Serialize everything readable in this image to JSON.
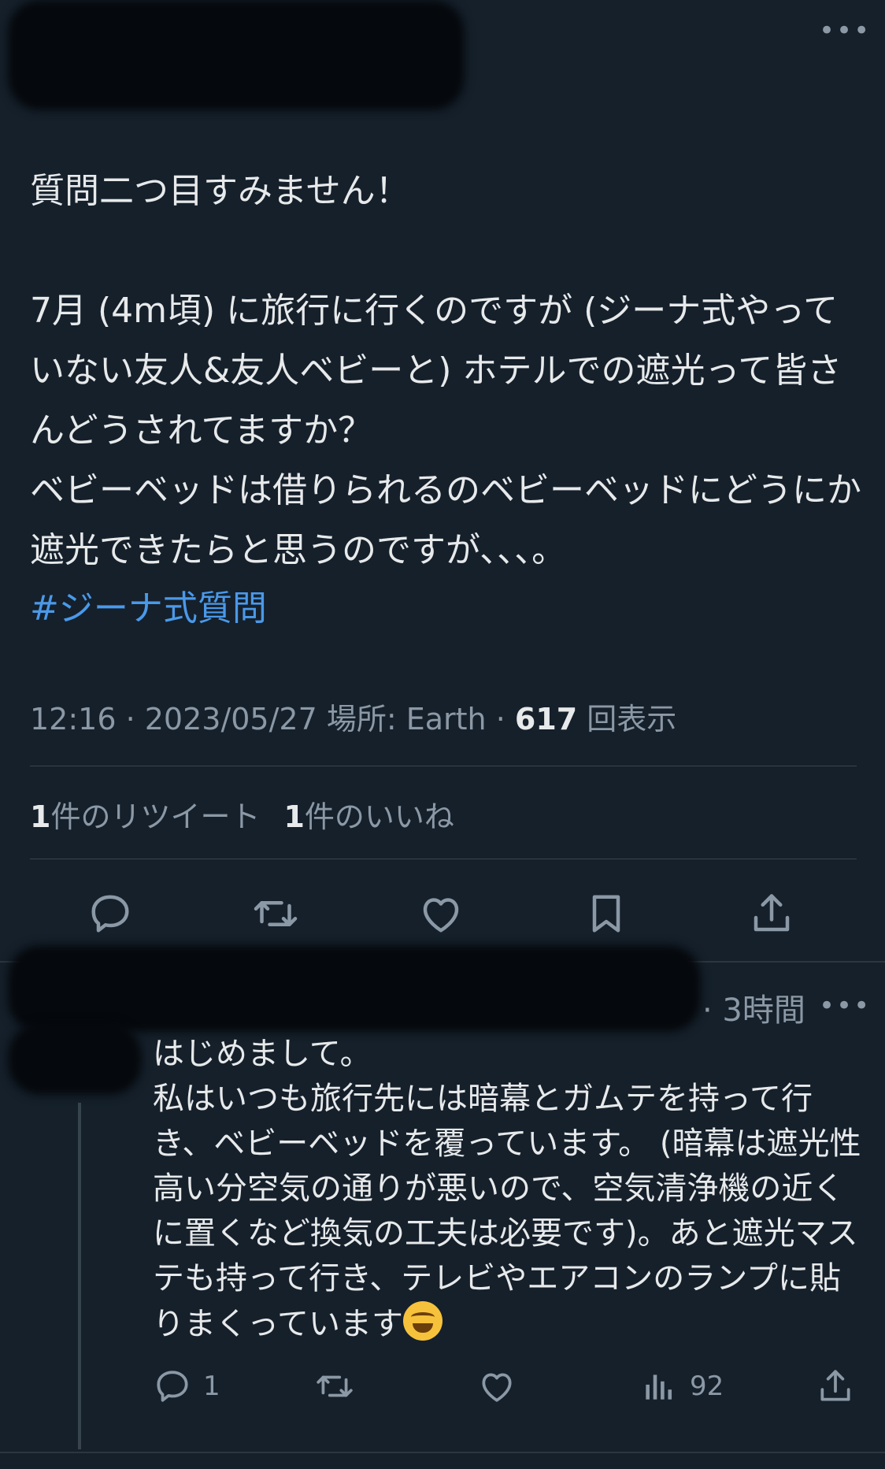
{
  "tweet": {
    "text": "質問二つ目すみません！\n\n7月 (4m頃) に旅行に行くのですが (ジーナ式やっていない友人&友人ベビーと) ホテルでの遮光って皆さんどうされてますか？\nベビーベッドは借りられるのベビーベッドにどうにか遮光できたらと思うのですが、、、。",
    "hashtag": "#ジーナ式質問",
    "meta_prefix": "12:16 · 2023/05/27 場所: Earth · ",
    "views_count": "617",
    "views_label": " 回表示",
    "retweets_count": "1",
    "retweets_label": "件のリツイート",
    "likes_count": "1",
    "likes_label": "件のいいね",
    "more_icon": "more-icon"
  },
  "reply": {
    "time": "· 3時間",
    "text": "はじめまして。\n私はいつも旅行先には暗幕とガムテを持って行き、ベビーベッドを覆っています。 (暗幕は遮光性高い分空気の通りが悪いので、空気清浄機の近くに置くなど換気の工夫は必要です)。あと遮光マステも持って行き、テレビやエアコンのランプに貼りまくっています",
    "emoji": "😂",
    "reply_count": "1",
    "views_count": "92"
  },
  "colors": {
    "background": "#15202b",
    "text": "#e7e9ea",
    "secondary": "#8b98a5",
    "link": "#4a99e9",
    "divider": "#38444d"
  }
}
